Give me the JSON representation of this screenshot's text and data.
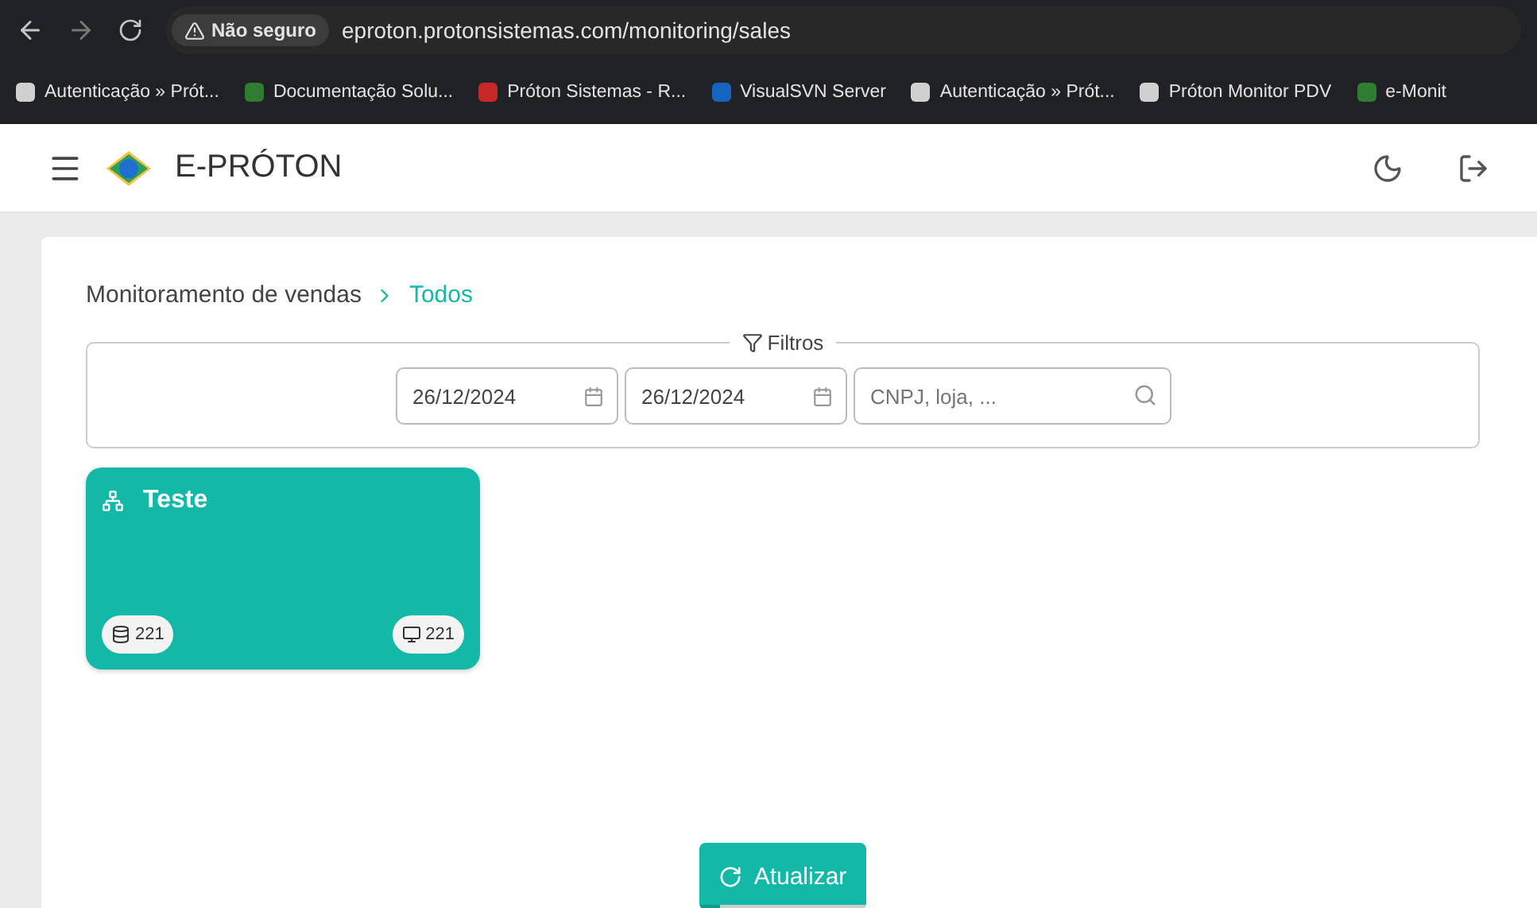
{
  "browser": {
    "security": "Não seguro",
    "url": "eproton.protonsistemas.com/monitoring/sales",
    "bookmarks": [
      {
        "label": "Autenticação » Prót...",
        "color": "#d0d0d0"
      },
      {
        "label": "Documentação Solu...",
        "color": "#2e7d32"
      },
      {
        "label": "Próton Sistemas - R...",
        "color": "#c62828"
      },
      {
        "label": "VisualSVN Server",
        "color": "#1565c0"
      },
      {
        "label": "Autenticação » Prót...",
        "color": "#d0d0d0"
      },
      {
        "label": "Próton Monitor PDV",
        "color": "#d0d0d0"
      },
      {
        "label": "e-Monit",
        "color": "#2e7d32"
      }
    ]
  },
  "app": {
    "brand": "E-PRÓTON"
  },
  "breadcrumb": {
    "title": "Monitoramento de vendas",
    "current": "Todos"
  },
  "filters": {
    "legend": "Filtros",
    "date_from": "26/12/2024",
    "date_to": "26/12/2024",
    "search": {
      "placeholder": "CNPJ, loja, ..."
    }
  },
  "groups": [
    {
      "name": "Teste",
      "databases": "221",
      "terminals": "221"
    }
  ],
  "refresh": {
    "label": "Atualizar",
    "level": 0.12
  }
}
